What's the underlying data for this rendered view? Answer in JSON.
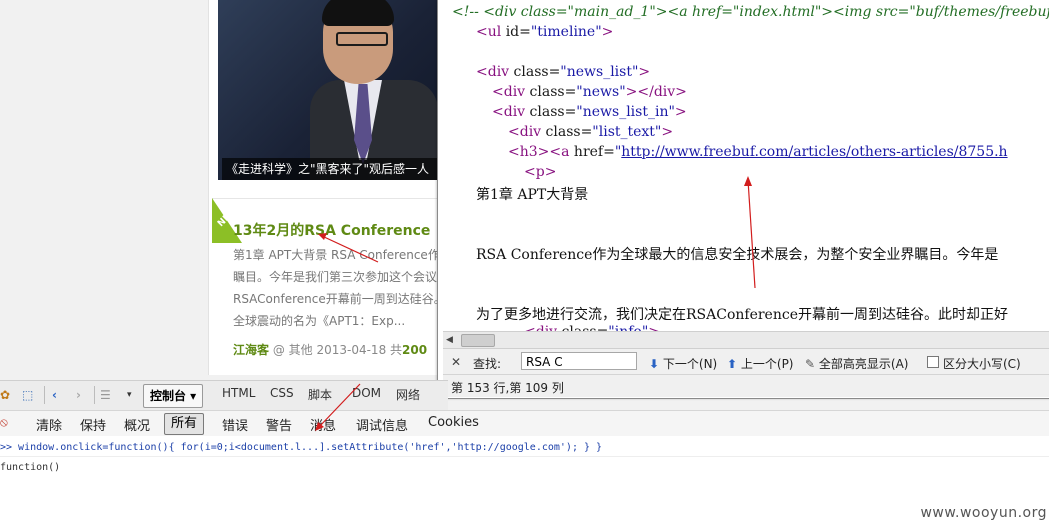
{
  "video": {
    "caption": "《走进科学》之\"黑客来了\"观后感一人"
  },
  "article": {
    "badge": "NEW",
    "title": "13年2月的RSA Conference",
    "excerpt_lines": [
      "第1章 APT大背景 RSA Conference作",
      "瞩目。今年是我们第三次参加这个会议",
      "RSAConference开幕前一周到达硅谷。",
      "全球震动的名为《APT1：Exp..."
    ],
    "author": "江海客",
    "meta": " @ 其他 2013-04-18 共",
    "count": "200"
  },
  "source": {
    "lines": [
      {
        "indent": 14,
        "tokens": [
          [
            "comment",
            "<!-- <div class=\"main_ad_1\"><a href=\"index.html\"><img src=\"buf/themes/freebuf"
          ]
        ]
      },
      {
        "indent": 38,
        "tokens": [
          [
            "tag",
            "<ul "
          ],
          [
            "attr",
            "id="
          ],
          [
            "val",
            "\"timeline\""
          ],
          [
            "tag",
            ">"
          ]
        ]
      },
      {
        "indent": 38,
        "tokens": []
      },
      {
        "indent": 38,
        "tokens": [
          [
            "tag",
            "<div "
          ],
          [
            "attr",
            "class="
          ],
          [
            "val",
            "\"news_list\""
          ],
          [
            "tag",
            ">"
          ]
        ]
      },
      {
        "indent": 54,
        "tokens": [
          [
            "tag",
            "<div "
          ],
          [
            "attr",
            "class="
          ],
          [
            "val",
            "\"news\""
          ],
          [
            "tag",
            "></div>"
          ]
        ]
      },
      {
        "indent": 54,
        "tokens": [
          [
            "tag",
            "<div "
          ],
          [
            "attr",
            "class="
          ],
          [
            "val",
            "\"news_list_in\""
          ],
          [
            "tag",
            ">"
          ]
        ]
      },
      {
        "indent": 70,
        "tokens": [
          [
            "tag",
            "<div "
          ],
          [
            "attr",
            "class="
          ],
          [
            "val",
            "\"list_text\""
          ],
          [
            "tag",
            ">"
          ]
        ]
      },
      {
        "indent": 70,
        "tokens": [
          [
            "tag",
            "<h3><a "
          ],
          [
            "attr",
            "href="
          ],
          [
            "val",
            "\""
          ],
          [
            "link",
            "http://www.freebuf.com/articles/others-articles/8755.h"
          ]
        ]
      },
      {
        "indent": 86,
        "tokens": [
          [
            "tag",
            "<p>"
          ]
        ]
      },
      {
        "indent": 38,
        "tokens": [
          [
            "text",
            "第1章          APT大背景"
          ]
        ]
      },
      {
        "indent": 38,
        "tokens": []
      },
      {
        "indent": 38,
        "tokens": []
      },
      {
        "indent": 38,
        "tokens": [
          [
            "text",
            "RSA Conference作为全球最大的信息安全技术展会，为整个安全业界瞩目。今年是"
          ]
        ]
      },
      {
        "indent": 38,
        "tokens": []
      },
      {
        "indent": 38,
        "tokens": []
      },
      {
        "indent": 38,
        "tokens": [
          [
            "text",
            "为了更多地进行交流，我们决定在RSAConference开幕前一周到达硅谷。此时却正好"
          ]
        ]
      },
      {
        "indent": 86,
        "tokens": [
          [
            "tag",
            "<div "
          ],
          [
            "attr",
            "class="
          ],
          [
            "val",
            "\"info\""
          ],
          [
            "tag",
            ">"
          ]
        ]
      }
    ]
  },
  "find_bar": {
    "close": "✕",
    "label": "查找:",
    "value": "RSA C",
    "next": "下一个(N)",
    "prev": "上一个(P)",
    "highlight_all": "全部高亮显示(A)",
    "match_case": "区分大小写(C)"
  },
  "status": {
    "position": "第 153 行,第 109 列"
  },
  "firebug": {
    "console_tab": "控制台 ▾",
    "tabs": [
      "HTML",
      "CSS",
      "脚本",
      "DOM",
      "网络"
    ],
    "filters": [
      "清除",
      "保持",
      "概况",
      "所有",
      "错误",
      "警告",
      "消息",
      "调试信息",
      "Cookies"
    ]
  },
  "console": {
    "command": ">> window.onclick=function(){  for(i=0;i<document.l...].setAttribute('href','http://google.com');  } }",
    "result": "function()"
  },
  "watermark": "www.wooyun.org",
  "colors": {
    "title_green": "#5f8a14",
    "link_blue": "#1a1aa6",
    "tag_purple": "#881280",
    "arrow_red": "#d21d1d"
  }
}
